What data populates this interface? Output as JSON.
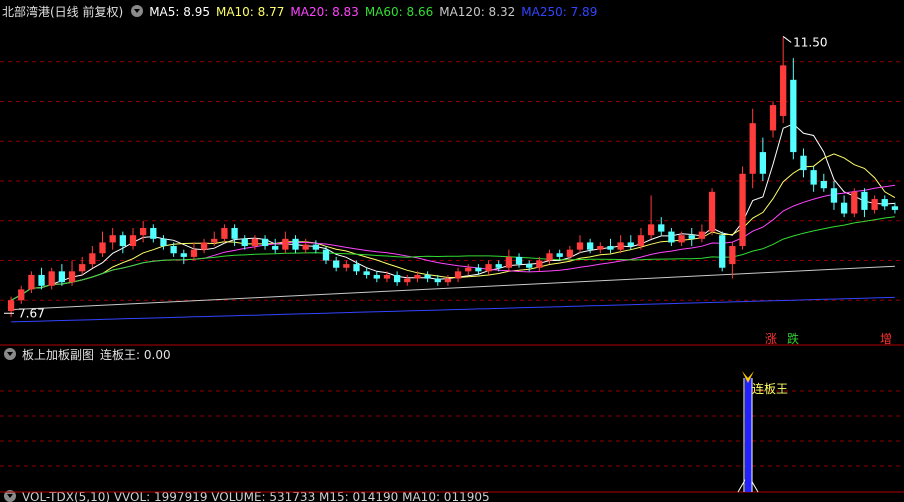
{
  "main_header": {
    "title": "北部湾港(日线 前复权)",
    "ma": [
      {
        "label": "MA5: 8.95",
        "color": "#ffffff"
      },
      {
        "label": "MA10: 8.77",
        "color": "#ffff66"
      },
      {
        "label": "MA20: 8.83",
        "color": "#ff44ff"
      },
      {
        "label": "MA60: 8.66",
        "color": "#33dd33"
      },
      {
        "label": "MA120: 8.32",
        "color": "#c8c8c8"
      },
      {
        "label": "MA250: 7.89",
        "color": "#3344ff"
      }
    ]
  },
  "annotations": {
    "high_price": "11.50",
    "low_price": "7.67",
    "badges": [
      {
        "text": "涨",
        "color": "#ff3333"
      },
      {
        "text": "跌",
        "color": "#33cc33"
      },
      {
        "text": "增",
        "color": "#ff3333"
      }
    ]
  },
  "sub_header": {
    "title": "板上加板副图",
    "value": "连板王: 0.00",
    "signal_label": "连板王"
  },
  "bottom_header": {
    "text": "VOL-TDX(5,10) VVOL: 1997919 VOLUME: 531733 M15: 014190 MA10: 011905"
  },
  "colors": {
    "up": "#ff3c3c",
    "down": "#54ffff",
    "grid": "#8b0000",
    "separator": "#b00000"
  },
  "chart_data": {
    "type": "candlestick",
    "title": "北部湾港(日线 前复权)",
    "high_marker": 11.5,
    "low_marker": 7.67,
    "candles": [
      [
        7.7,
        7.85,
        7.62,
        7.9
      ],
      [
        7.85,
        8.0,
        7.8,
        8.05
      ],
      [
        8.0,
        8.2,
        7.95,
        8.25
      ],
      [
        8.2,
        8.05,
        8.0,
        8.3
      ],
      [
        8.05,
        8.25,
        8.0,
        8.3
      ],
      [
        8.25,
        8.1,
        8.05,
        8.35
      ],
      [
        8.1,
        8.25,
        8.05,
        8.4
      ],
      [
        8.25,
        8.35,
        8.2,
        8.45
      ],
      [
        8.35,
        8.5,
        8.3,
        8.6
      ],
      [
        8.5,
        8.65,
        8.45,
        8.8
      ],
      [
        8.65,
        8.75,
        8.55,
        8.85
      ],
      [
        8.75,
        8.6,
        8.5,
        8.8
      ],
      [
        8.6,
        8.75,
        8.55,
        8.85
      ],
      [
        8.75,
        8.85,
        8.65,
        8.95
      ],
      [
        8.85,
        8.7,
        8.65,
        8.9
      ],
      [
        8.7,
        8.6,
        8.55,
        8.75
      ],
      [
        8.6,
        8.5,
        8.45,
        8.65
      ],
      [
        8.5,
        8.45,
        8.35,
        8.55
      ],
      [
        8.45,
        8.55,
        8.4,
        8.65
      ],
      [
        8.55,
        8.65,
        8.5,
        8.7
      ],
      [
        8.65,
        8.7,
        8.6,
        8.8
      ],
      [
        8.7,
        8.85,
        8.65,
        8.9
      ],
      [
        8.85,
        8.7,
        8.6,
        8.9
      ],
      [
        8.7,
        8.6,
        8.55,
        8.75
      ],
      [
        8.6,
        8.7,
        8.55,
        8.75
      ],
      [
        8.7,
        8.6,
        8.55,
        8.75
      ],
      [
        8.6,
        8.55,
        8.5,
        8.7
      ],
      [
        8.55,
        8.7,
        8.5,
        8.8
      ],
      [
        8.7,
        8.55,
        8.5,
        8.75
      ],
      [
        8.55,
        8.62,
        8.5,
        8.7
      ],
      [
        8.62,
        8.55,
        8.5,
        8.68
      ],
      [
        8.55,
        8.4,
        8.35,
        8.6
      ],
      [
        8.4,
        8.3,
        8.25,
        8.45
      ],
      [
        8.3,
        8.35,
        8.25,
        8.4
      ],
      [
        8.35,
        8.25,
        8.2,
        8.4
      ],
      [
        8.25,
        8.2,
        8.15,
        8.3
      ],
      [
        8.2,
        8.15,
        8.1,
        8.25
      ],
      [
        8.15,
        8.2,
        8.1,
        8.25
      ],
      [
        8.2,
        8.1,
        8.05,
        8.25
      ],
      [
        8.1,
        8.15,
        8.05,
        8.2
      ],
      [
        8.15,
        8.2,
        8.1,
        8.25
      ],
      [
        8.2,
        8.15,
        8.1,
        8.25
      ],
      [
        8.15,
        8.1,
        8.05,
        8.2
      ],
      [
        8.1,
        8.15,
        8.05,
        8.2
      ],
      [
        8.15,
        8.25,
        8.1,
        8.3
      ],
      [
        8.25,
        8.3,
        8.2,
        8.35
      ],
      [
        8.3,
        8.25,
        8.2,
        8.35
      ],
      [
        8.25,
        8.35,
        8.2,
        8.4
      ],
      [
        8.35,
        8.3,
        8.25,
        8.4
      ],
      [
        8.3,
        8.45,
        8.25,
        8.55
      ],
      [
        8.45,
        8.35,
        8.3,
        8.5
      ],
      [
        8.35,
        8.3,
        8.25,
        8.4
      ],
      [
        8.3,
        8.4,
        8.25,
        8.45
      ],
      [
        8.4,
        8.5,
        8.35,
        8.55
      ],
      [
        8.5,
        8.45,
        8.4,
        8.55
      ],
      [
        8.45,
        8.55,
        8.4,
        8.6
      ],
      [
        8.55,
        8.65,
        8.5,
        8.75
      ],
      [
        8.65,
        8.55,
        8.5,
        8.7
      ],
      [
        8.55,
        8.6,
        8.5,
        8.65
      ],
      [
        8.6,
        8.55,
        8.5,
        8.7
      ],
      [
        8.55,
        8.65,
        8.5,
        8.75
      ],
      [
        8.65,
        8.6,
        8.55,
        8.75
      ],
      [
        8.6,
        8.75,
        8.55,
        8.85
      ],
      [
        8.75,
        8.9,
        8.7,
        9.3
      ],
      [
        8.9,
        8.8,
        8.75,
        9.0
      ],
      [
        8.8,
        8.65,
        8.6,
        8.85
      ],
      [
        8.65,
        8.75,
        8.6,
        8.8
      ],
      [
        8.75,
        8.7,
        8.6,
        8.85
      ],
      [
        8.7,
        8.8,
        8.65,
        8.9
      ],
      [
        8.8,
        9.35,
        8.75,
        9.4
      ],
      [
        8.75,
        8.3,
        8.25,
        8.8
      ],
      [
        8.35,
        8.6,
        8.15,
        8.65
      ],
      [
        8.6,
        9.6,
        8.55,
        9.7
      ],
      [
        9.6,
        10.3,
        9.4,
        10.5
      ],
      [
        9.9,
        9.6,
        9.5,
        10.1
      ],
      [
        10.2,
        10.55,
        10.1,
        10.6
      ],
      [
        10.4,
        11.1,
        10.3,
        11.5
      ],
      [
        10.9,
        9.9,
        9.8,
        11.2
      ],
      [
        9.85,
        9.65,
        9.55,
        9.95
      ],
      [
        9.65,
        9.45,
        9.35,
        9.7
      ],
      [
        9.5,
        9.4,
        9.35,
        9.6
      ],
      [
        9.4,
        9.2,
        9.1,
        9.5
      ],
      [
        9.2,
        9.05,
        9.0,
        9.3
      ],
      [
        9.05,
        9.35,
        9.0,
        9.4
      ],
      [
        9.35,
        9.1,
        9.0,
        9.4
      ],
      [
        9.1,
        9.25,
        9.05,
        9.3
      ],
      [
        9.25,
        9.15,
        9.1,
        9.3
      ],
      [
        9.15,
        9.1,
        9.05,
        9.2
      ]
    ]
  }
}
